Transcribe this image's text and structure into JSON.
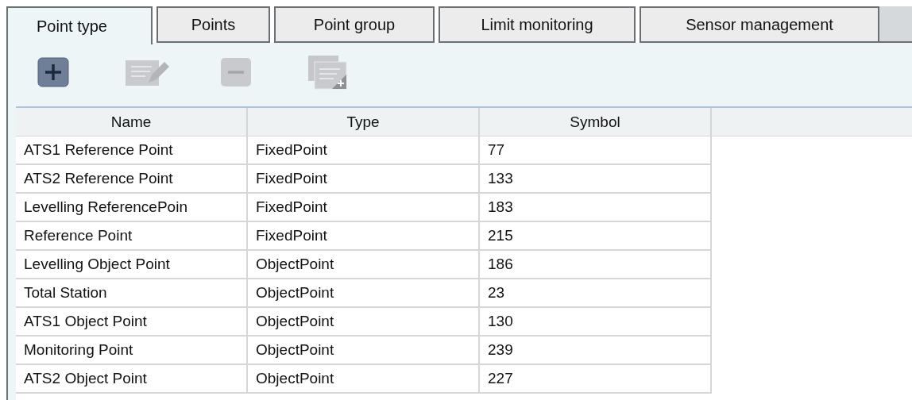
{
  "tabs": [
    {
      "label": "Point type",
      "selected": true
    },
    {
      "label": "Points",
      "selected": false
    },
    {
      "label": "Point group",
      "selected": false
    },
    {
      "label": "Limit monitoring",
      "selected": false
    },
    {
      "label": "Sensor management",
      "selected": false
    }
  ],
  "toolbar": [
    {
      "kind": "add",
      "disabled": false
    },
    {
      "kind": "edit",
      "disabled": true
    },
    {
      "kind": "remove",
      "disabled": true
    },
    {
      "kind": "duplicate",
      "disabled": true
    }
  ],
  "table": {
    "columns": [
      "Name",
      "Type",
      "Symbol"
    ],
    "rows": [
      [
        "ATS1 Reference Point",
        "FixedPoint",
        "77"
      ],
      [
        "ATS2 Reference Point",
        "FixedPoint",
        "133"
      ],
      [
        "Levelling ReferencePoin",
        "FixedPoint",
        "183"
      ],
      [
        "Reference Point",
        "FixedPoint",
        "215"
      ],
      [
        "Levelling Object Point",
        "ObjectPoint",
        "186"
      ],
      [
        "Total Station",
        "ObjectPoint",
        "23"
      ],
      [
        "ATS1 Object Point",
        "ObjectPoint",
        "130"
      ],
      [
        "Monitoring Point",
        "ObjectPoint",
        "239"
      ],
      [
        "ATS2 Object Point",
        "ObjectPoint",
        "227"
      ]
    ]
  }
}
